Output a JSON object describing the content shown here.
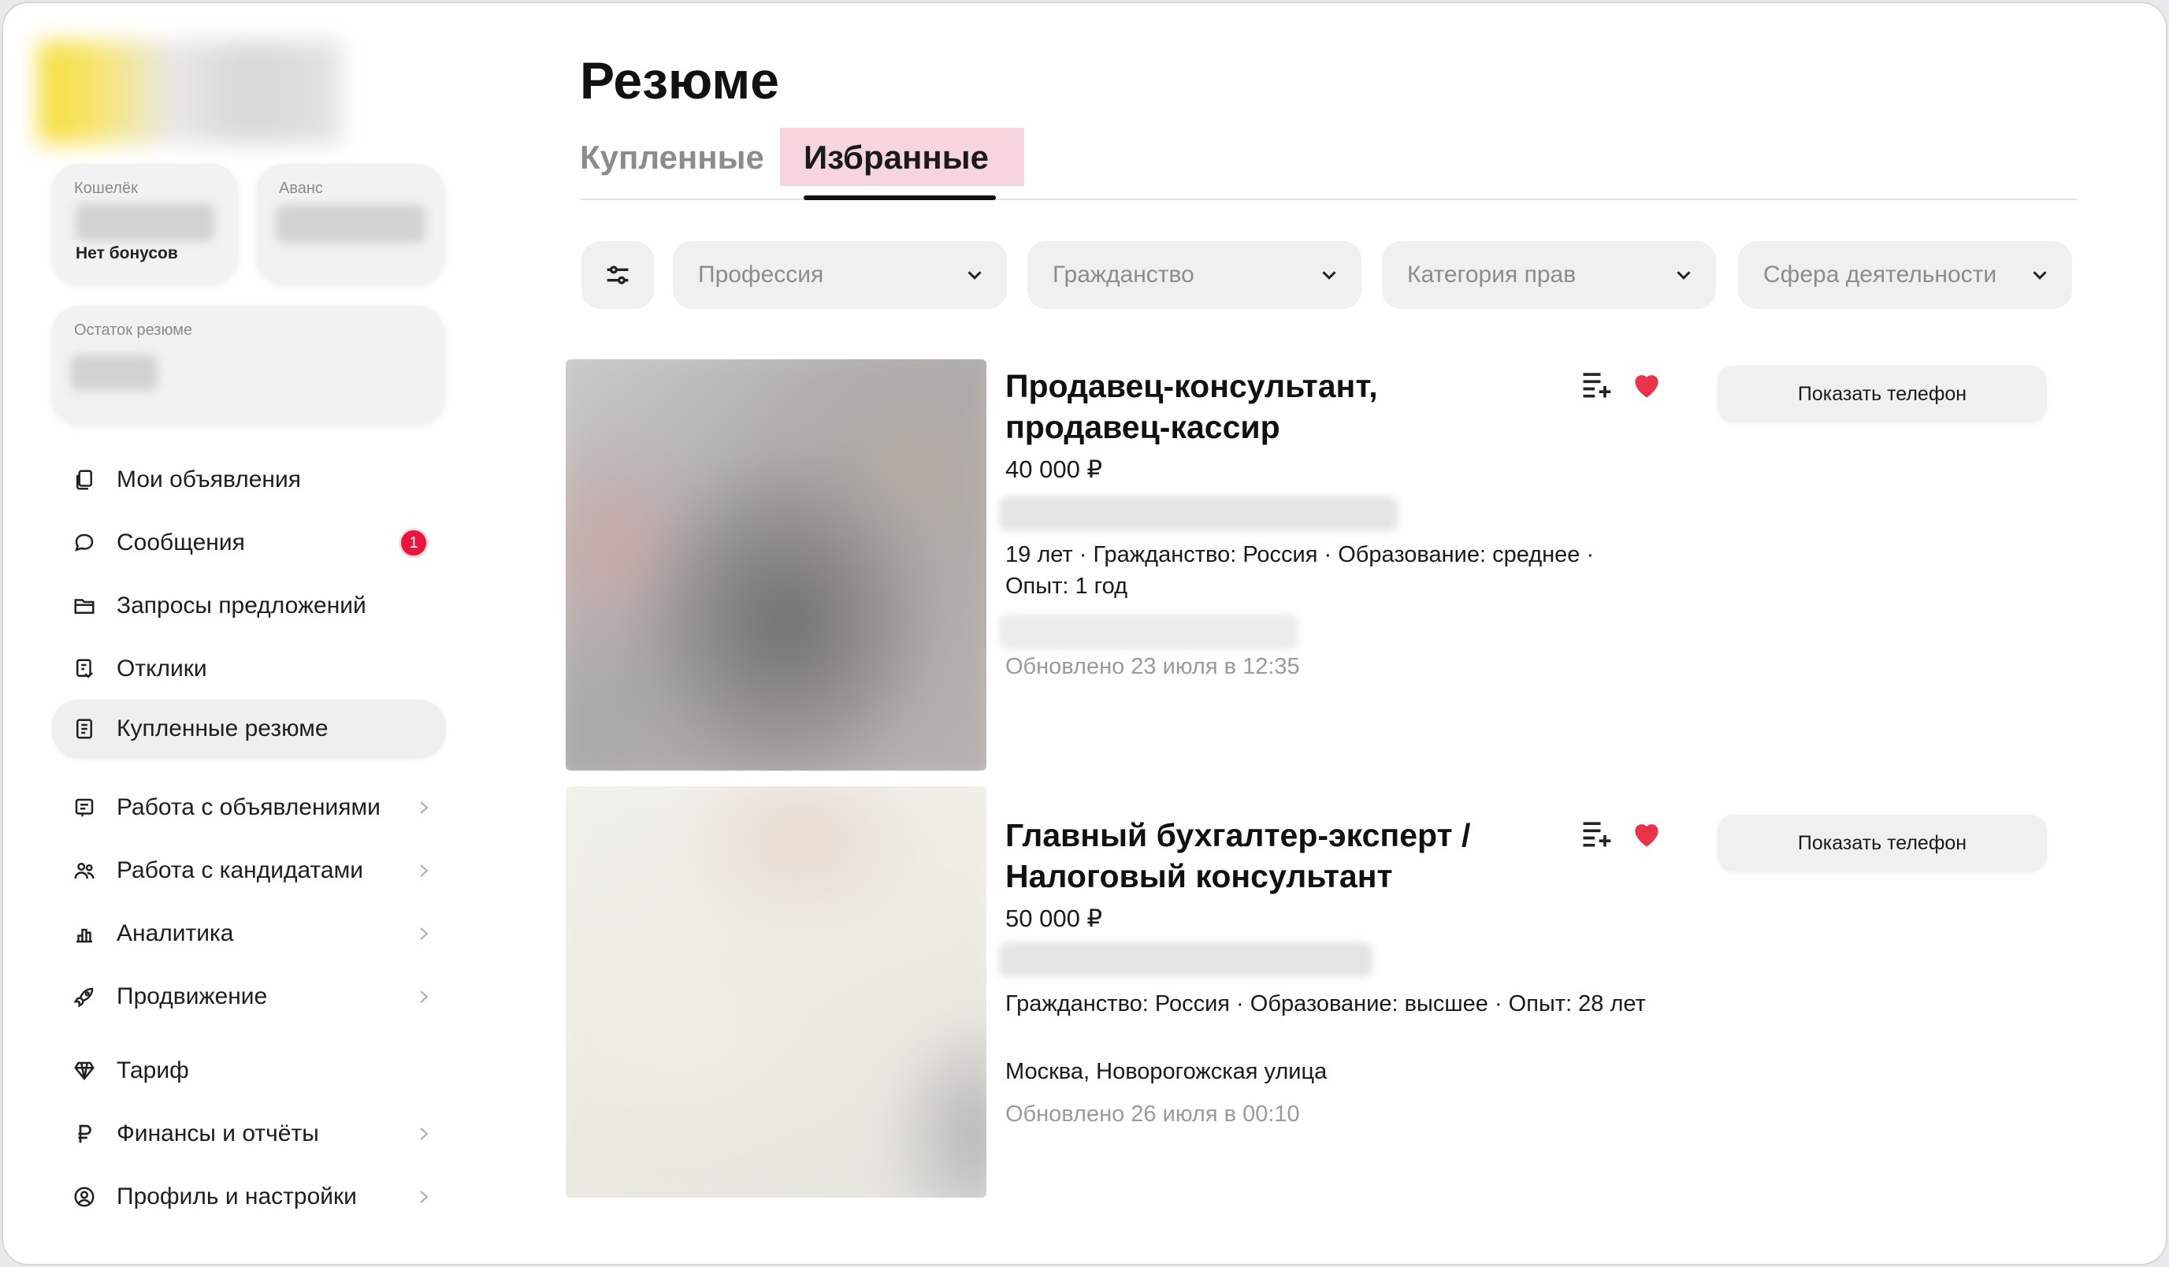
{
  "sidebar": {
    "wallet": {
      "label": "Кошелёк",
      "note": "Нет бонусов"
    },
    "advance": {
      "label": "Аванс"
    },
    "resume_balance": {
      "label": "Остаток резюме"
    },
    "items": [
      {
        "label": "Мои объявления",
        "icon": "listings-icon"
      },
      {
        "label": "Сообщения",
        "icon": "chat-bubble-icon",
        "badge": "1"
      },
      {
        "label": "Запросы предложений",
        "icon": "folder-icon"
      },
      {
        "label": "Отклики",
        "icon": "responses-icon"
      },
      {
        "label": "Купленные резюме",
        "icon": "document-icon",
        "active": true
      },
      {
        "label": "Работа с объявлениями",
        "icon": "board-icon"
      },
      {
        "label": "Работа с кандидатами",
        "icon": "people-icon"
      },
      {
        "label": "Аналитика",
        "icon": "analytics-icon"
      },
      {
        "label": "Продвижение",
        "icon": "rocket-icon"
      },
      {
        "label": "Тариф",
        "icon": "diamond-icon"
      },
      {
        "label": "Финансы и отчёты",
        "icon": "ruble-icon"
      },
      {
        "label": "Профиль и настройки",
        "icon": "profile-icon"
      }
    ]
  },
  "main": {
    "title": "Резюме",
    "tabs": [
      {
        "label": "Купленные",
        "active": false
      },
      {
        "label": "Избранные",
        "active": true
      }
    ],
    "filters": [
      "Профессия",
      "Гражданство",
      "Категория прав",
      "Сфера деятельности"
    ],
    "resumes": [
      {
        "title": "Продавец-консультант, продавец-кассир",
        "salary": "40 000 ₽",
        "meta": "19 лет · Гражданство: Россия · Образование: среднее · Опыт: 1 год",
        "location": "",
        "updated": "Обновлено 23 июля в 12:35",
        "phone_button": "Показать телефон",
        "favorite": true
      },
      {
        "title": "Главный бухгалтер-эксперт / Налоговый консультант",
        "salary": "50 000 ₽",
        "meta": "Гражданство: Россия · Образование: высшее · Опыт: 28 лет",
        "location": "Москва, Новорогожская улица",
        "updated": "Обновлено 26 июля в 00:10",
        "phone_button": "Показать телефон",
        "favorite": true
      }
    ]
  },
  "colors": {
    "accent_red": "#e8163c",
    "heart": "#e8334a",
    "tab_highlight": "#f6d6dc",
    "surface": "#f0f0f0"
  }
}
